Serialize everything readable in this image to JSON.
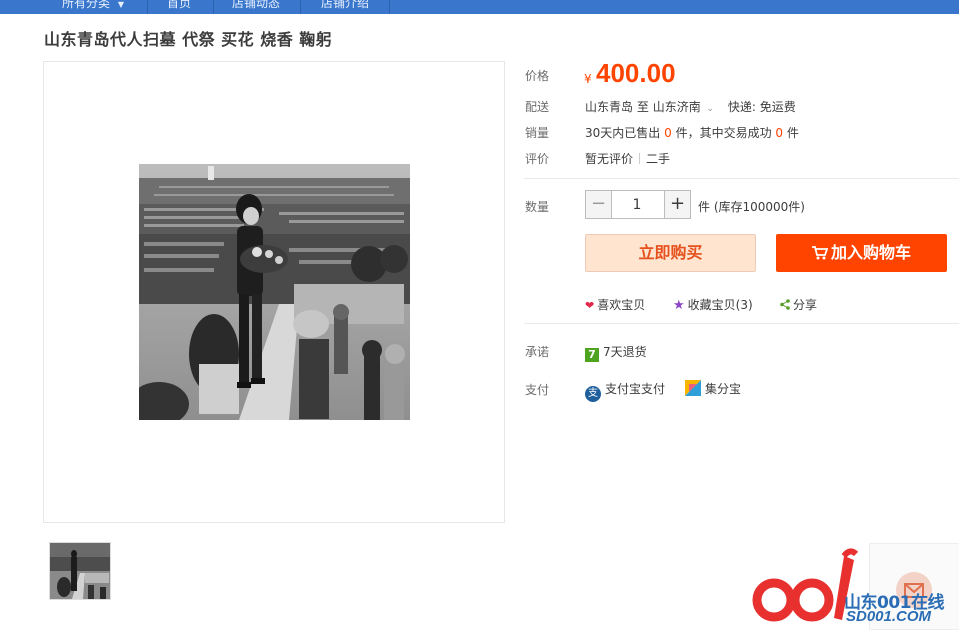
{
  "topnav": {
    "items": [
      "所有分类",
      "首页",
      "店铺动态",
      "店铺介绍"
    ],
    "dropdown_glyph": "▼"
  },
  "product": {
    "title": "山东青岛代人扫墓 代祭 买花 烧香 鞠躬"
  },
  "price": {
    "label": "价格",
    "currency": "¥",
    "value": "400.00"
  },
  "delivery": {
    "label": "配送",
    "from": "山东青岛",
    "to_word": "至",
    "dest": "山东济南",
    "express": "快递: 免运费"
  },
  "sales": {
    "label": "销量",
    "prefix": "30天内已售出",
    "sold": "0",
    "unit1": "件，其中交易成功",
    "success": "0",
    "unit2": "件"
  },
  "review": {
    "label": "评价",
    "text": "暂无评价",
    "condition": "二手"
  },
  "quantity": {
    "label": "数量",
    "value": "1",
    "minus": "−",
    "plus": "+",
    "stock": "件 (库存100000件)"
  },
  "buttons": {
    "buy_now": "立即购买",
    "add_cart": "加入购物车"
  },
  "actions": {
    "like": "喜欢宝贝",
    "favorite": "收藏宝贝(3)",
    "share": "分享"
  },
  "promise": {
    "label": "承诺",
    "badge": "7",
    "text": "7天退货"
  },
  "payment": {
    "label": "支付",
    "alipay": "支付宝支付",
    "alipay_icon_char": "支",
    "jifenbao": "集分宝"
  },
  "watermark": {
    "logo": "001",
    "site_cn": "山东001在线",
    "site_url": "SD001.COM"
  },
  "colors": {
    "accent": "#ff4400",
    "nav_bg": "#3a77cc",
    "green": "#4ea31f"
  },
  "icons": [
    "dropdown-arrow-icon",
    "heart-icon",
    "star-icon",
    "share-icon",
    "cart-icon",
    "alipay-icon",
    "jifenbao-icon",
    "mail-icon"
  ]
}
